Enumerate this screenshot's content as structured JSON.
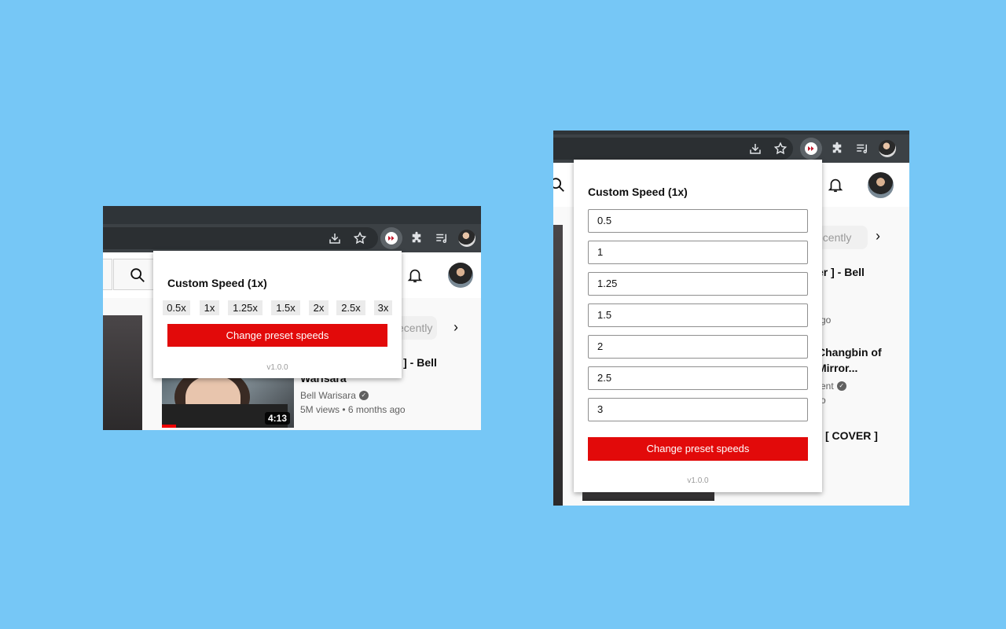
{
  "colors": {
    "background": "#76c7f6",
    "accent": "#e20a0a",
    "toolbar": "#3c4145"
  },
  "popup": {
    "title": "Custom Speed (1x)",
    "presets": [
      "0.5x",
      "1x",
      "1.25x",
      "1.5x",
      "2x",
      "2.5x",
      "3x"
    ],
    "change_label": "Change preset speeds",
    "version": "v1.0.0",
    "edit_values": [
      "0.5",
      "1",
      "1.25",
      "1.5",
      "2",
      "2.5",
      "3"
    ]
  },
  "youtube_left": {
    "chip": "ecently",
    "video": {
      "title_line1": "er ] - Bell",
      "title_line2": "Warisara",
      "channel": "Bell Warisara",
      "meta": "5M views • 6 months ago",
      "duration": "4:13"
    }
  },
  "youtube_right": {
    "chip": "ecently",
    "v1_title": "er ] - Bell",
    "v1_meta": "go",
    "v2_title1": "Changbin of",
    "v2_title2": "Mirror...",
    "v2_channel": "ent",
    "v2_meta": "o",
    "v3_title": "[ COVER ]"
  },
  "icons": [
    "download-icon",
    "star-icon",
    "speed-extension-icon",
    "puzzle-icon",
    "media-icon",
    "profile-avatar",
    "search-icon",
    "bell-icon",
    "chevron-right-icon",
    "verified-icon"
  ]
}
